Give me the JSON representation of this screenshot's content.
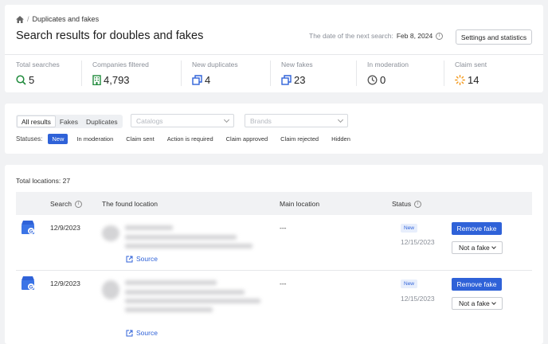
{
  "breadcrumb": {
    "current": "Duplicates and fakes"
  },
  "header": {
    "title": "Search results for doubles and fakes",
    "next_search_label": "The date of the next search:",
    "next_search_date": "Feb 8, 2024",
    "stats_button": "Settings and statistics"
  },
  "stats": [
    {
      "label": "Total searches",
      "value": "5",
      "icon": "search-icon"
    },
    {
      "label": "Companies filtered",
      "value": "4,793",
      "icon": "building-icon"
    },
    {
      "label": "New duplicates",
      "value": "4",
      "icon": "copy-icon"
    },
    {
      "label": "New fakes",
      "value": "23",
      "icon": "copy-icon"
    },
    {
      "label": "In moderation",
      "value": "0",
      "icon": "clock-icon"
    },
    {
      "label": "Claim sent",
      "value": "14",
      "icon": "spinner-icon"
    }
  ],
  "filters": {
    "tabs": [
      "All results",
      "Fakes",
      "Duplicates"
    ],
    "catalogs_placeholder": "Catalogs",
    "brands_placeholder": "Brands",
    "statuses_label": "Statuses:",
    "statuses": [
      "New",
      "In moderation",
      "Claim sent",
      "Action is required",
      "Claim approved",
      "Claim rejected",
      "Hidden"
    ]
  },
  "table": {
    "total_label": "Total locations:",
    "total": "27",
    "columns": [
      "Search",
      "The found location",
      "Main location",
      "Status"
    ],
    "rows": [
      {
        "search_date": "12/9/2023",
        "source_label": "Source",
        "main_location": "---",
        "status": "New",
        "status_date": "12/15/2023",
        "remove_label": "Remove fake",
        "not_fake_label": "Not a fake"
      },
      {
        "search_date": "12/9/2023",
        "source_label": "Source",
        "main_location": "---",
        "status": "New",
        "status_date": "12/15/2023",
        "remove_label": "Remove fake",
        "not_fake_label": "Not a fake"
      }
    ]
  },
  "colors": {
    "accent": "#2f62d8",
    "search_green": "#1f8a3b",
    "claim_orange": "#f39a1e"
  }
}
